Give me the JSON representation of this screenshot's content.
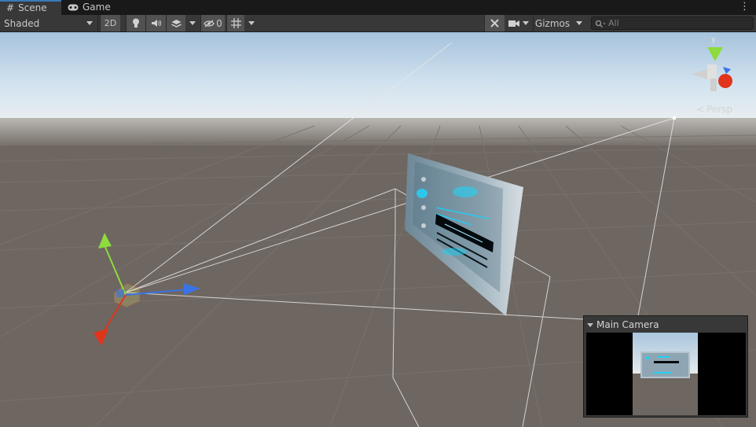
{
  "tabs": [
    {
      "label": "Scene",
      "icon": "grid-icon",
      "active": true
    },
    {
      "label": "Game",
      "icon": "gamepad-icon",
      "active": false
    }
  ],
  "toolbar": {
    "shading_mode": "Shaded",
    "mode_2d_label": "2D",
    "hidden_count": "0",
    "gizmos_label": "Gizmos",
    "search_placeholder": "All"
  },
  "scene": {
    "orientation_gizmo_axis_label": "y",
    "projection_label": "Persp"
  },
  "camera_preview": {
    "title": "Main Camera"
  },
  "colors": {
    "accent": "#3a79bb",
    "sky_top": "#bcd7f0",
    "ground": "#6e6660",
    "axis_x": "#e0341b",
    "axis_y": "#8edb3d",
    "axis_z": "#3a73e6"
  }
}
